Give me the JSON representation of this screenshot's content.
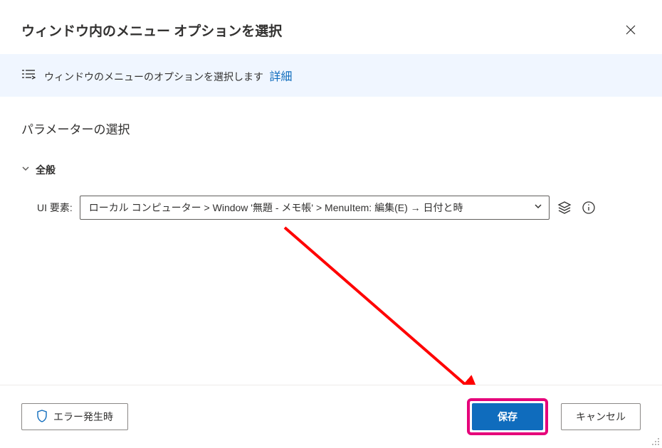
{
  "header": {
    "title": "ウィンドウ内のメニュー オプションを選択"
  },
  "info": {
    "text": "ウィンドウのメニューのオプションを選択します",
    "link": "詳細"
  },
  "section": {
    "title": "パラメーターの選択",
    "general_label": "全般"
  },
  "field": {
    "label": "UI 要素:",
    "value": "ローカル コンピューター > Window '無題 - メモ帳' > MenuItem: 編集(E) → 日付と時"
  },
  "footer": {
    "error_button": "エラー発生時",
    "save": "保存",
    "cancel": "キャンセル"
  }
}
